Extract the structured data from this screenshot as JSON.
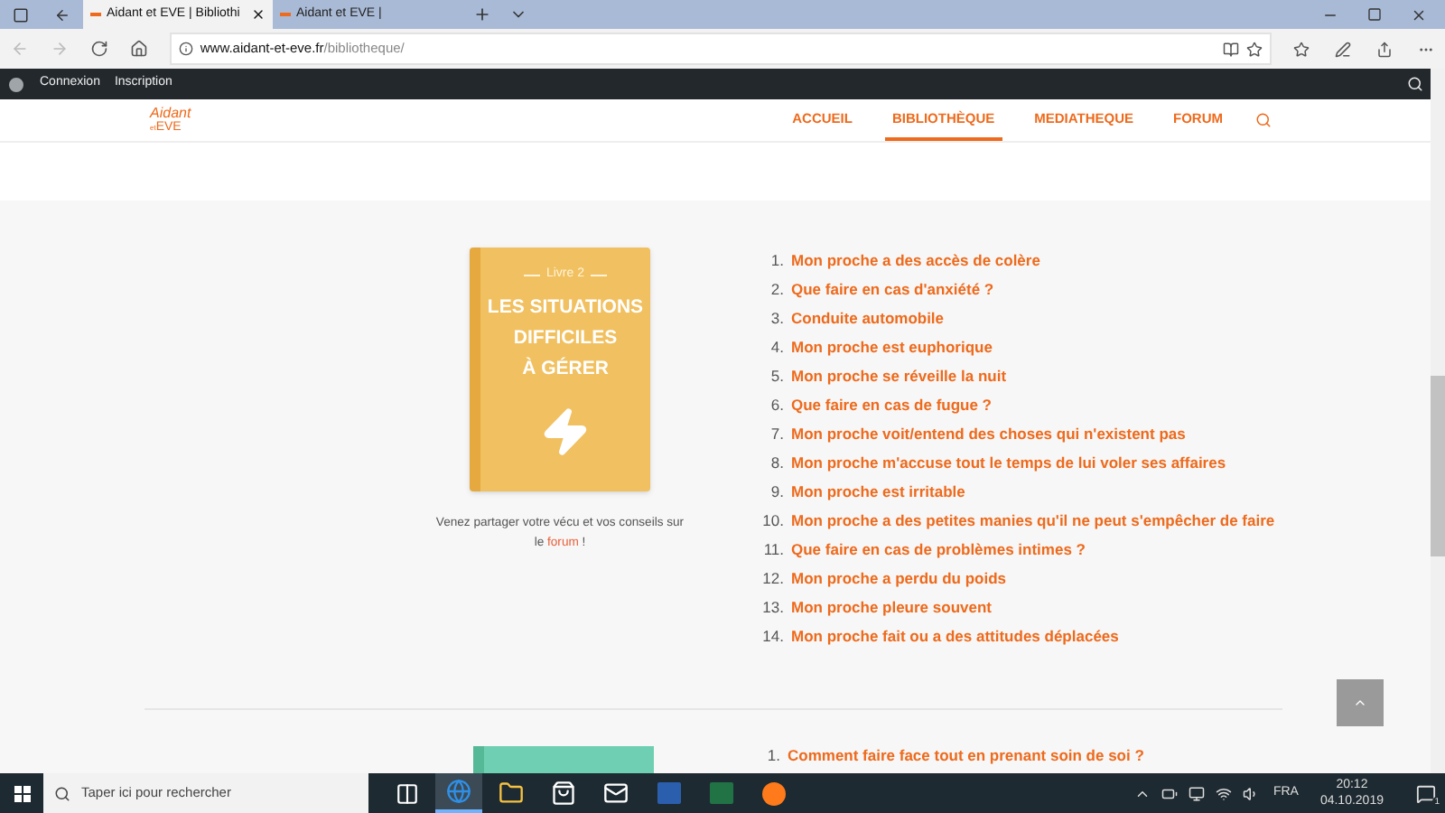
{
  "browser": {
    "tabs": [
      {
        "title": "Aidant et EVE | Bibliothi",
        "selected": true
      },
      {
        "title": "Aidant et EVE |",
        "selected": false
      }
    ],
    "url": {
      "host": "www.aidant-et-eve.fr",
      "path": "/bibliotheque/"
    }
  },
  "admin_bar": {
    "items": [
      "Connexion",
      "Inscription"
    ]
  },
  "site": {
    "logo": {
      "name": "Aidant",
      "small": "et",
      "brand": "EVE"
    },
    "nav": [
      {
        "label": "ACCUEIL",
        "selected": false
      },
      {
        "label": "BIBLIOTHÈQUE",
        "selected": true
      },
      {
        "label": "MEDIATHEQUE",
        "selected": false
      },
      {
        "label": "FORUM",
        "selected": false
      }
    ]
  },
  "book": {
    "kicker": "Livre 2",
    "title_lines": [
      "LES SITUATIONS",
      "DIFFICILES",
      "À GÉRER"
    ],
    "caption": {
      "before": "Venez partager votre vécu et vos conseils sur le",
      "link": "forum",
      "after": "!"
    },
    "chapters": [
      {
        "number": "1.",
        "title": "Mon proche a des accès de colère"
      },
      {
        "number": "2.",
        "title": "Que faire en cas d'anxiété ?"
      },
      {
        "number": "3.",
        "title": "Conduite automobile"
      },
      {
        "number": "4.",
        "title": "Mon proche est euphorique"
      },
      {
        "number": "5.",
        "title": "Mon proche se réveille la nuit"
      },
      {
        "number": "6.",
        "title": "Que faire en cas de fugue ?"
      },
      {
        "number": "7.",
        "title": "Mon proche voit/entend des choses qui n'existent pas"
      },
      {
        "number": "8.",
        "title": "Mon proche m'accuse tout le temps de lui voler ses affaires"
      },
      {
        "number": "9.",
        "title": "Mon proche est irritable"
      },
      {
        "number": "10.",
        "title": "Mon proche a des petites manies qu'il ne peut s'empêcher de faire"
      },
      {
        "number": "11.",
        "title": "Que faire en cas de problèmes intimes ?"
      },
      {
        "number": "12.",
        "title": "Mon proche a perdu du poids"
      },
      {
        "number": "13.",
        "title": "Mon proche pleure souvent"
      },
      {
        "number": "14.",
        "title": "Mon proche fait ou a des attitudes déplacées"
      }
    ]
  },
  "next_book": {
    "chapters": [
      {
        "number": "1.",
        "title": "Comment faire face tout en prenant soin de soi ?"
      }
    ]
  },
  "taskbar": {
    "search_placeholder": "Taper ici pour rechercher",
    "apps": [
      {
        "kind": "taskview",
        "selected": false
      },
      {
        "kind": "edge",
        "selected": true
      },
      {
        "kind": "explorer",
        "selected": false
      },
      {
        "kind": "store",
        "selected": false
      },
      {
        "kind": "mail",
        "selected": false
      },
      {
        "kind": "word",
        "selected": false
      },
      {
        "kind": "excel",
        "selected": false
      },
      {
        "kind": "firefox",
        "selected": false
      }
    ],
    "language": "FRA",
    "time": "20:12",
    "date": "04.10.2019",
    "notifications": "1"
  }
}
